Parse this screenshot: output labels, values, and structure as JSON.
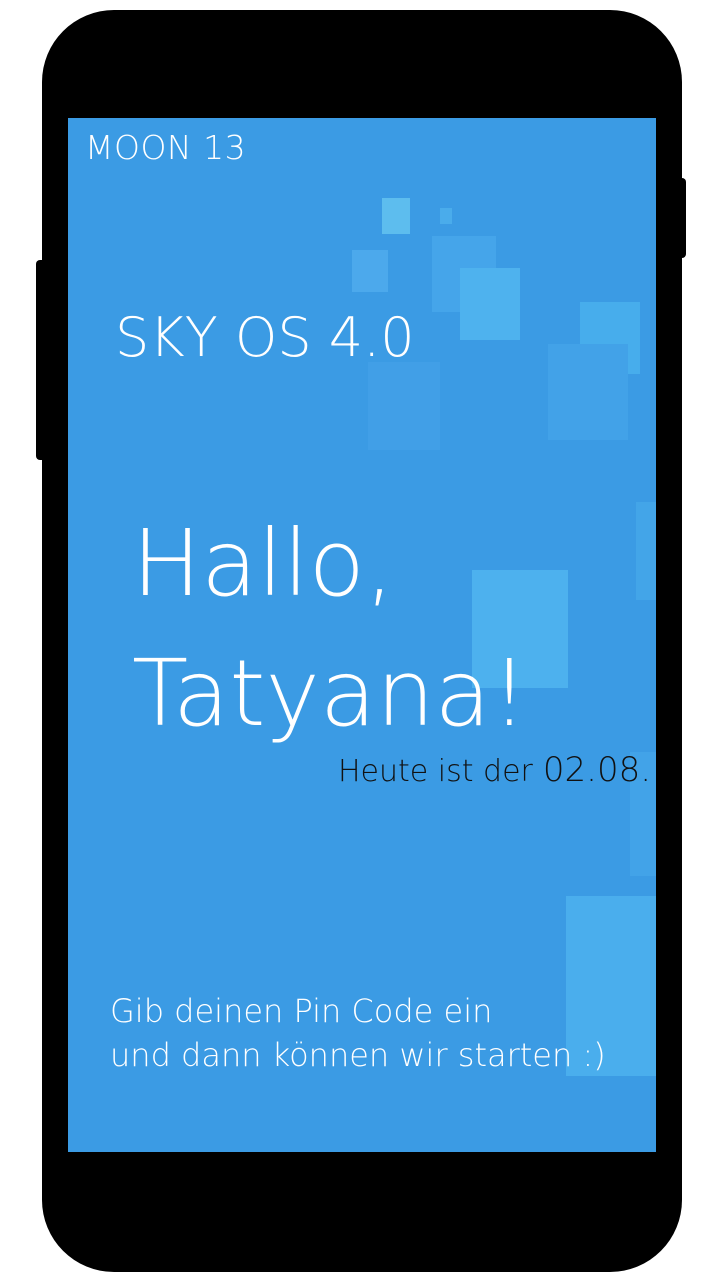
{
  "brand": "MOON 13",
  "os_name": "SKY OS 4.0",
  "greeting": {
    "line1": "Hallo,",
    "line2": "Tatyana!"
  },
  "date": {
    "label": "Heute ist der",
    "value": "02.08."
  },
  "pin_prompt": {
    "line1": "Gib deinen Pin Code ein",
    "line2": "und dann können wir starten :)"
  },
  "colors": {
    "screen_bg": "#3b9be4",
    "frame": "#000000",
    "accent_light": "#4db1ee"
  }
}
